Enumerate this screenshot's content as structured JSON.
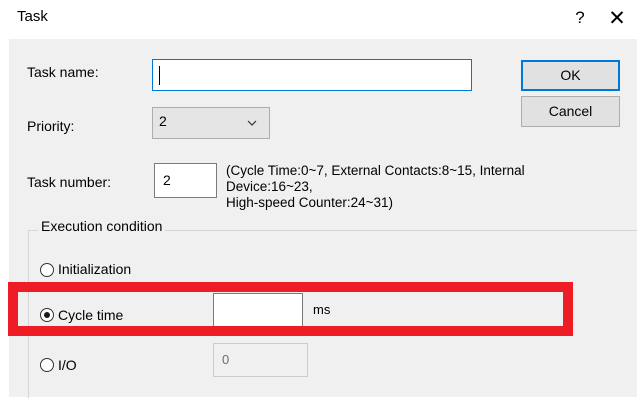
{
  "window": {
    "title": "Task",
    "help_label": "?",
    "close_label": "✕"
  },
  "form": {
    "task_name_label": "Task name:",
    "task_name_value": "",
    "priority_label": "Priority:",
    "priority_value": "2",
    "task_number_label": "Task number:",
    "task_number_value": "2",
    "task_number_desc_1": "(Cycle Time:0~7, External Contacts:8~15, Internal",
    "task_number_desc_2": "Device:16~23,",
    "task_number_desc_3": "High-speed Counter:24~31)"
  },
  "buttons": {
    "ok": "OK",
    "cancel": "Cancel"
  },
  "execution": {
    "group_title": "Execution condition",
    "initialization_label": "Initialization",
    "cycle_time_label": "Cycle time",
    "cycle_time_value": "",
    "cycle_time_unit": "ms",
    "io_label": "I/O",
    "io_value": "0",
    "selected": "cycle_time"
  },
  "colors": {
    "highlight": "#ee1c25",
    "focus_border": "#0078d7",
    "dialog_bg": "#f0f0f0"
  }
}
